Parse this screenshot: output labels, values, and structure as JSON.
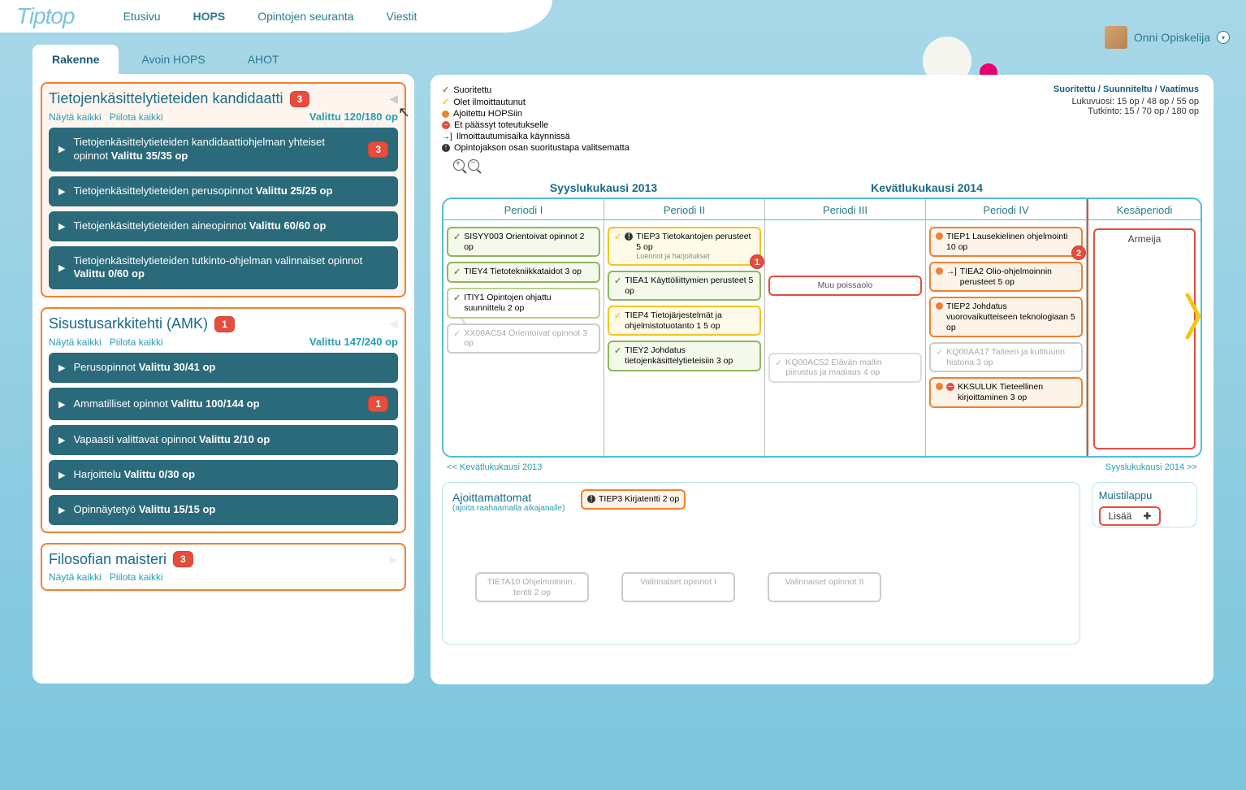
{
  "logo": "Tiptop",
  "topnav": [
    "Etusivu",
    "HOPS",
    "Opintojen seuranta",
    "Viestit"
  ],
  "topnav_active": 1,
  "user": "Onni Opiskelija",
  "tabs": [
    "Rakenne",
    "Avoin HOPS",
    "AHOT"
  ],
  "tabs_active": 0,
  "programs": [
    {
      "title": "Tietojenkäsittelytieteiden kandidaatti",
      "badge": "3",
      "show_all": "Näytä kaikki",
      "hide_all": "Piilota kaikki",
      "selected": "Valittu 120/180 op",
      "items": [
        {
          "text": "Tietojenkäsittelytieteiden kandidaattiohjelman yhteiset opinnot ",
          "bold": "Valittu 35/35 op",
          "badge": "3"
        },
        {
          "text": "Tietojenkäsittelytieteiden perusopinnot ",
          "bold": "Valittu 25/25 op"
        },
        {
          "text": "Tietojenkäsittelytieteiden aineopinnot ",
          "bold": "Valittu 60/60 op"
        },
        {
          "text": "Tietojenkäsittelytieteiden tutkinto-ohjelman valinnaiset opinnot ",
          "bold": "Valittu 0/60 op"
        }
      ]
    },
    {
      "title": "Sisustusarkkitehti (AMK)",
      "badge": "1",
      "show_all": "Näytä kaikki",
      "hide_all": "Piilota kaikki",
      "selected": "Valittu 147/240 op",
      "items": [
        {
          "text": "Perusopinnot ",
          "bold": "Valittu 30/41 op"
        },
        {
          "text": "Ammatilliset opinnot ",
          "bold": "Valittu 100/144 op",
          "badge": "1"
        },
        {
          "text": "Vapaasti valittavat opinnot ",
          "bold": "Valittu 2/10 op"
        },
        {
          "text": "Harjoittelu ",
          "bold": "Valittu 0/30 op"
        },
        {
          "text": "Opinnäytetyö ",
          "bold": "Valittu 15/15 op"
        }
      ]
    },
    {
      "title": "Filosofian maisteri",
      "badge": "3",
      "show_all": "Näytä kaikki",
      "hide_all": "Piilota kaikki",
      "selected": "",
      "items": []
    }
  ],
  "legend": {
    "suoritettu": "Suoritettu",
    "ilmoittautunut": "Olet ilmoittautunut",
    "ajoitettu": "Ajoitettu HOPSiin",
    "et_paassyt": "Et päässyt toteutukselle",
    "ilmo_aika": "Ilmoittautumisaika käynnissä",
    "valitsematta": "Opintojakson osan suoritustapa valitsematta"
  },
  "stats": {
    "header": "Suoritettu / Suunniteltu / Vaatimus",
    "lukuvuosi": "Lukuvuosi: 15 op / 48 op / 55 op",
    "tutkinto": "Tutkinto: 15 / 70 op / 180 op"
  },
  "semesters": [
    "Syyslukukausi 2013",
    "Kevätlukukausi 2014"
  ],
  "periods": [
    "Periodi I",
    "Periodi II",
    "Periodi III",
    "Periodi IV",
    "Kesäperiodi"
  ],
  "summer_content": "Armeija",
  "courses": {
    "p1": [
      {
        "cls": "green",
        "icon": "g",
        "text": "SISYY003 Orientoivat opinnot 2 op"
      },
      {
        "cls": "green",
        "icon": "g",
        "text": "TIEY4 Tietotekniikkataidot 3 op"
      },
      {
        "cls": "green-light",
        "icon": "g",
        "text": "ITIY1 Opintojen ohjattu suunnittelu 2 op"
      },
      {
        "cls": "grey-dash",
        "icon": "gr",
        "text": "XX00AC54 Orientoivat opinnot 3 op"
      }
    ],
    "p2": [
      {
        "cls": "yellow",
        "icon": "y",
        "text": "TIEP3 Tietokantojen perusteet 5 op",
        "sub": "Luennot ja harjoitukset",
        "badge": "1",
        "warn": true
      },
      {
        "cls": "green",
        "icon": "g",
        "text": "TIEA1 Käyttöliittymien perusteet 5 op"
      },
      {
        "cls": "yellow",
        "icon": "y",
        "text": "TIEP4 Tietojärjestelmät ja ohjelmistotuotanto 1 5 op"
      },
      {
        "cls": "green",
        "icon": "g",
        "text": "TIEY2 Johdatus tietojenkäsittelytieteisiin 3 op"
      }
    ],
    "p3": [
      {
        "cls": "red-box",
        "text": "Muu poissaolo"
      },
      {
        "cls": "yellow-dash",
        "icon": "gr",
        "text": "KQ00AC52 Elävän mallin piirustus ja maalaus 4 op"
      }
    ],
    "p4": [
      {
        "cls": "orange",
        "icon": "o",
        "text": "TIEP1 Lausekielinen ohjelmointi 10 op",
        "badge": "2"
      },
      {
        "cls": "orange",
        "icon": "o",
        "text": "TIEA2 Olio-ohjelmoinnin perusteet 5 op",
        "arrow": true
      },
      {
        "cls": "orange",
        "icon": "o",
        "text": "TIEP2 Johdatus vuorovaikutteiseen teknologiaan 5 op"
      },
      {
        "cls": "grey-dash",
        "icon": "gr",
        "text": "KQ00AA17 Taiteen ja kulttuurin historia 3 op"
      },
      {
        "cls": "orange",
        "icon": "o",
        "text": "KKSULUK Tieteellinen kirjoittaminen 3 op",
        "stop": true
      }
    ]
  },
  "nav_prev": "<< Kevätlukukausi 2013",
  "nav_next": "Syyslukukausi 2014 >>",
  "unscheduled": {
    "title": "Ajoittamattomat",
    "sub": "(ajoita raahaamalla aikajanalle)",
    "items_top": [
      {
        "cls": "orange",
        "text": "TIEP3 Kirjatentti 2 op",
        "warn": true
      }
    ],
    "items_bottom": [
      {
        "cls": "grey-dash",
        "text": "TIETA10  Ohjelmoinnin.. tentti 2 op"
      },
      {
        "cls": "grey-dash",
        "text": "Valinnaiset opinnot I"
      },
      {
        "cls": "grey-dash",
        "text": "Valinnaiset opinnot II"
      }
    ]
  },
  "note": {
    "title": "Muistilappu",
    "btn": "Lisää"
  }
}
